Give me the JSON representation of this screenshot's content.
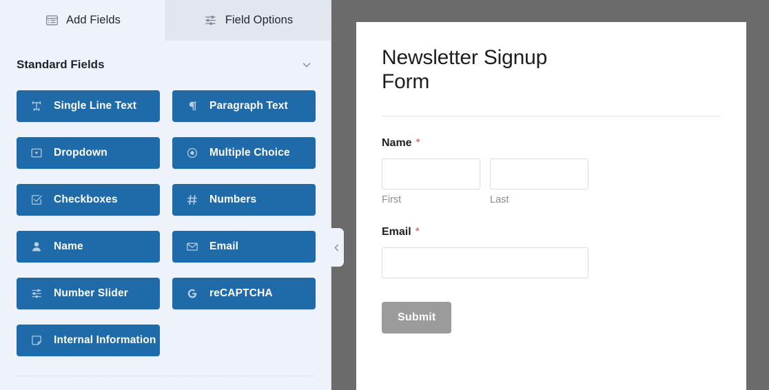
{
  "builder": {
    "tabs": [
      {
        "label": "Add Fields",
        "icon": "add-fields-icon",
        "active": true
      },
      {
        "label": "Field Options",
        "icon": "sliders-icon",
        "active": false
      }
    ],
    "section": {
      "title": "Standard Fields",
      "toggle_icon": "chevron-down-icon"
    },
    "fields": [
      {
        "label": "Single Line Text",
        "icon": "text-cursor-icon"
      },
      {
        "label": "Paragraph Text",
        "icon": "pilcrow-icon"
      },
      {
        "label": "Dropdown",
        "icon": "dropdown-icon"
      },
      {
        "label": "Multiple Choice",
        "icon": "radio-icon"
      },
      {
        "label": "Checkboxes",
        "icon": "checkbox-icon"
      },
      {
        "label": "Numbers",
        "icon": "hash-icon"
      },
      {
        "label": "Name",
        "icon": "user-icon"
      },
      {
        "label": "Email",
        "icon": "envelope-icon"
      },
      {
        "label": "Number Slider",
        "icon": "slider-icon"
      },
      {
        "label": "reCAPTCHA",
        "icon": "google-g-icon"
      },
      {
        "label": "Internal Information",
        "icon": "note-icon"
      }
    ],
    "collapse_handle_icon": "chevron-left-icon",
    "colors": {
      "field_button": "#1f6aa8",
      "panel_bg": "#eef3fb"
    }
  },
  "preview": {
    "form_title": "Newsletter Signup Form",
    "fields": [
      {
        "label": "Name",
        "required_marker": "*",
        "inputs": [
          {
            "value": "",
            "placeholder": "",
            "sublabel": "First"
          },
          {
            "value": "",
            "placeholder": "",
            "sublabel": "Last"
          }
        ]
      },
      {
        "label": "Email",
        "required_marker": "*",
        "inputs": [
          {
            "value": "",
            "placeholder": "",
            "sublabel": ""
          }
        ]
      }
    ],
    "submit_label": "Submit",
    "colors": {
      "submit_bg": "#9b9b9b",
      "required": "#d9534f",
      "backdrop": "#6b6b6b"
    }
  }
}
